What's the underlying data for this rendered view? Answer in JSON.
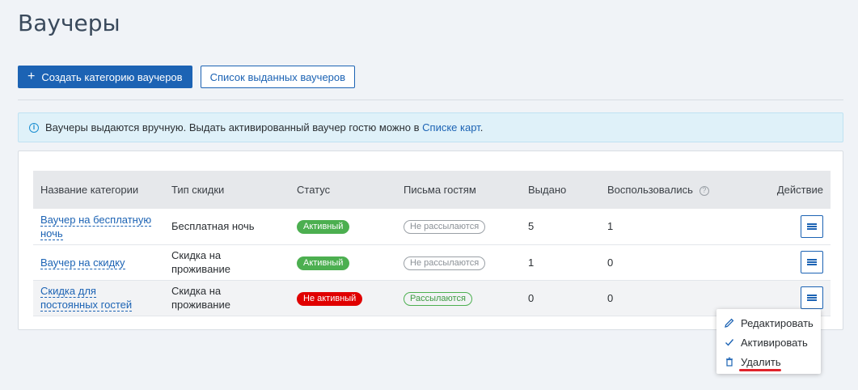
{
  "page": {
    "title": "Ваучеры"
  },
  "toolbar": {
    "create_label": "Создать категорию ваучеров",
    "list_label": "Список выданных ваучеров"
  },
  "alert": {
    "text": "Ваучеры выдаются вручную. Выдать активированный ваучер гостю можно в ",
    "link": "Списке карт",
    "suffix": "."
  },
  "table": {
    "headers": {
      "name": "Название категории",
      "type": "Тип скидки",
      "status": "Статус",
      "letters": "Письма гостям",
      "issued": "Выдано",
      "used": "Воспользовались",
      "action": "Действие"
    },
    "rows": [
      {
        "name_line1": "Ваучер на бесплатную",
        "name_line2": "ночь",
        "type_line1": "Бесплатная ночь",
        "type_line2": "",
        "status": "Активный",
        "letters": "Не рассылаются",
        "issued": "5",
        "used": "1"
      },
      {
        "name_line1": "Ваучер на скидку",
        "name_line2": "",
        "type_line1": "Скидка на",
        "type_line2": "проживание",
        "status": "Активный",
        "letters": "Не рассылаются",
        "issued": "1",
        "used": "0"
      },
      {
        "name_line1": "Скидка для",
        "name_line2": "постоянных гостей",
        "type_line1": "Скидка на",
        "type_line2": "проживание",
        "status": "Не активный",
        "letters": "Рассылаются",
        "issued": "0",
        "used": "0"
      }
    ]
  },
  "dropdown": {
    "items": [
      {
        "label": "Редактировать",
        "icon": "pencil-icon"
      },
      {
        "label": "Активировать",
        "icon": "check-icon"
      },
      {
        "label": "Удалить",
        "icon": "trash-icon"
      }
    ]
  },
  "colors": {
    "primary": "#1c63b4",
    "active_badge": "#4caf50",
    "inactive_badge": "#e00000",
    "alert_bg": "#dff1f9",
    "delete_underline": "#e0222b"
  }
}
